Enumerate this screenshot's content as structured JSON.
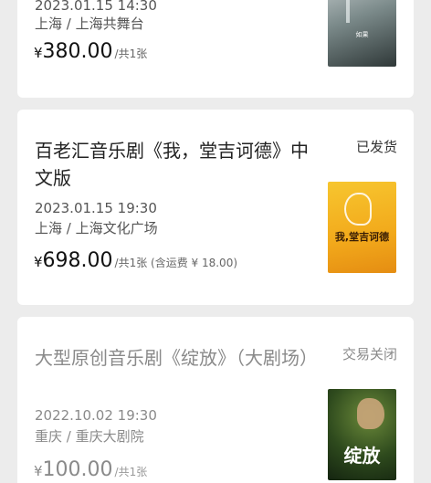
{
  "orders": [
    {
      "datetime": "2023.01.15 14:30",
      "venue": "上海 / 上海共舞台",
      "currency": "¥",
      "amount": "380.00",
      "count": "/共1张",
      "poster_icon": "poster-image",
      "poster_caption": "如果"
    },
    {
      "title": "百老汇音乐剧《我，堂吉诃德》中文版",
      "status": "已发货",
      "datetime": "2023.01.15 19:30",
      "venue": "上海 / 上海文化广场",
      "currency": "¥",
      "amount": "698.00",
      "count": "/共1张 (含运费 ¥ 18.00)",
      "poster_icon": "poster-image",
      "poster_caption": "我,堂吉诃德"
    },
    {
      "title": "大型原创音乐剧《绽放》（大剧场）",
      "status": "交易关闭",
      "datetime": "2022.10.02 19:30",
      "venue": "重庆 / 重庆大剧院",
      "currency": "¥",
      "amount": "100.00",
      "count": "/共1张",
      "poster_icon": "poster-image",
      "poster_caption": "绽放"
    }
  ]
}
